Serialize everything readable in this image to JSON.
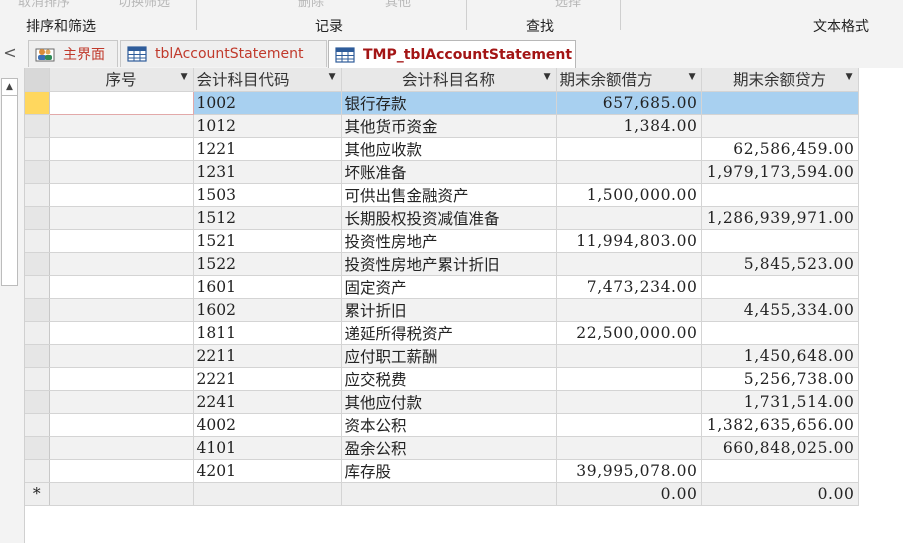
{
  "ribbon": {
    "ghost_items": [
      "取消排序",
      "切换筛选",
      "删除",
      "其他",
      "选择"
    ],
    "groups": [
      "排序和筛选",
      "记录",
      "查找",
      "文本格式"
    ]
  },
  "tabs": [
    {
      "label": "主界面",
      "icon": "form-people-icon",
      "color": "#c0392b"
    },
    {
      "label": "tblAccountStatement",
      "icon": "table-icon",
      "color": "#c0392b"
    },
    {
      "label": "TMP_tblAccountStatement",
      "icon": "table-icon",
      "color": "#a31515"
    }
  ],
  "nav_collapse": "<",
  "columns": [
    "序号",
    "会计科目代码",
    "会计科目名称",
    "期末余额借方",
    "期末余额贷方"
  ],
  "rows": [
    {
      "seq": "",
      "code": "1002",
      "name": "银行存款",
      "debit": "657,685.00",
      "credit": ""
    },
    {
      "seq": "",
      "code": "1012",
      "name": "其他货币资金",
      "debit": "1,384.00",
      "credit": ""
    },
    {
      "seq": "",
      "code": "1221",
      "name": "其他应收款",
      "debit": "",
      "credit": "62,586,459.00"
    },
    {
      "seq": "",
      "code": "1231",
      "name": "坏账准备",
      "debit": "",
      "credit": "1,979,173,594.00"
    },
    {
      "seq": "",
      "code": "1503",
      "name": "可供出售金融资产",
      "debit": "1,500,000.00",
      "credit": ""
    },
    {
      "seq": "",
      "code": "1512",
      "name": "长期股权投资减值准备",
      "debit": "",
      "credit": "1,286,939,971.00"
    },
    {
      "seq": "",
      "code": "1521",
      "name": "投资性房地产",
      "debit": "11,994,803.00",
      "credit": ""
    },
    {
      "seq": "",
      "code": "1522",
      "name": "投资性房地产累计折旧",
      "debit": "",
      "credit": "5,845,523.00"
    },
    {
      "seq": "",
      "code": "1601",
      "name": "固定资产",
      "debit": "7,473,234.00",
      "credit": ""
    },
    {
      "seq": "",
      "code": "1602",
      "name": "累计折旧",
      "debit": "",
      "credit": "4,455,334.00"
    },
    {
      "seq": "",
      "code": "1811",
      "name": "递延所得税资产",
      "debit": "22,500,000.00",
      "credit": ""
    },
    {
      "seq": "",
      "code": "2211",
      "name": "应付职工薪酬",
      "debit": "",
      "credit": "1,450,648.00"
    },
    {
      "seq": "",
      "code": "2221",
      "name": "应交税费",
      "debit": "",
      "credit": "5,256,738.00"
    },
    {
      "seq": "",
      "code": "2241",
      "name": "其他应付款",
      "debit": "",
      "credit": "1,731,514.00"
    },
    {
      "seq": "",
      "code": "4002",
      "name": "资本公积",
      "debit": "",
      "credit": "1,382,635,656.00"
    },
    {
      "seq": "",
      "code": "4101",
      "name": "盈余公积",
      "debit": "",
      "credit": "660,848,025.00"
    },
    {
      "seq": "",
      "code": "4201",
      "name": "库存股",
      "debit": "39,995,078.00",
      "credit": ""
    }
  ],
  "new_row": {
    "marker": "*",
    "debit": "0.00",
    "credit": "0.00"
  },
  "current_row_index": 0,
  "colors": {
    "selection": "#a8d0f0",
    "current_marker": "#ffd75e",
    "tab_text": "#c0392b"
  }
}
